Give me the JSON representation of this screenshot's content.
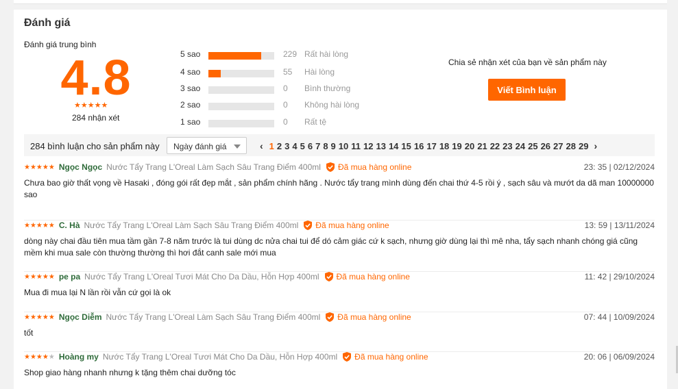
{
  "section_title": "Đánh giá",
  "summary": {
    "label": "Đánh giá trung bình",
    "score": "4.8",
    "stars": "★★★★★",
    "count_text": "284 nhận xét"
  },
  "distribution": [
    {
      "label": "5 sao",
      "count": "229",
      "text": "Rất hài lòng",
      "fill": 0.8
    },
    {
      "label": "4 sao",
      "count": "55",
      "text": "Hài lòng",
      "fill": 0.19
    },
    {
      "label": "3 sao",
      "count": "0",
      "text": "Bình thường",
      "fill": 0
    },
    {
      "label": "2 sao",
      "count": "0",
      "text": "Không hài lòng",
      "fill": 0
    },
    {
      "label": "1 sao",
      "count": "0",
      "text": "Rất tệ",
      "fill": 0
    }
  ],
  "share": {
    "text": "Chia sẻ nhận xét của bạn về sản phẩm này",
    "button": "Viết Bình luận"
  },
  "toolbar": {
    "count_text": "284 bình luận cho sản phẩm này",
    "sort_label": "Ngày đánh giá"
  },
  "pagination": {
    "prev": "‹",
    "next": "›",
    "active": "1",
    "pages": [
      "1",
      "2",
      "3",
      "4",
      "5",
      "6",
      "7",
      "8",
      "9",
      "10",
      "11",
      "12",
      "13",
      "14",
      "15",
      "16",
      "17",
      "18",
      "19",
      "20",
      "21",
      "22",
      "23",
      "24",
      "25",
      "26",
      "27",
      "28",
      "29"
    ]
  },
  "reviews": [
    {
      "stars": "★★★★★",
      "stars_off": "",
      "author": "Ngọc Ngọc",
      "product": "Nước Tẩy Trang L'Oreal Làm Sạch Sâu Trang Điểm 400ml",
      "verified": "Đã mua hàng online",
      "time": "23: 35 | 02/12/2024",
      "body": "Chưa bao giờ thất vọng về Hasaki , đóng gói rất đẹp mắt , sản phẩm chính hãng . Nước tẩy trang mình dùng đến chai thứ 4-5 rồi ý , sạch sâu và mướt da dã man 10000000 sao"
    },
    {
      "stars": "★★★★★",
      "stars_off": "",
      "author": "C. Hà",
      "product": "Nước Tẩy Trang L'Oreal Làm Sạch Sâu Trang Điểm 400ml",
      "verified": "Đã mua hàng online",
      "time": "13: 59 | 13/11/2024",
      "body": "dòng này chai đầu tiên mua tầm gần 7-8 năm trước là tui dùng dc nửa chai tui để dó cảm giác cứ k sạch, nhưng giờ dùng lại thì mê nha, tẩy sạch nhanh chóng giá cũng mềm khi mua sale còn thường thường thì hơi đắt canh sale mới mua"
    },
    {
      "stars": "★★★★★",
      "stars_off": "",
      "author": "pe pa",
      "product": "Nước Tẩy Trang L'Oreal Tươi Mát Cho Da Dầu, Hỗn Hợp 400ml",
      "verified": "Đã mua hàng online",
      "time": "11: 42 | 29/10/2024",
      "body": "Mua đi mua lại N lần rồi vẫn cứ gọi là ok"
    },
    {
      "stars": "★★★★★",
      "stars_off": "",
      "author": "Ngọc Diễm",
      "product": "Nước Tẩy Trang L'Oreal Làm Sạch Sâu Trang Điểm 400ml",
      "verified": "Đã mua hàng online",
      "time": "07: 44 | 10/09/2024",
      "body": "tốt"
    },
    {
      "stars": "★★★★",
      "stars_off": "★",
      "author": "Hoàng my",
      "product": "Nước Tẩy Trang L'Oreal Tươi Mát Cho Da Dầu, Hỗn Hợp 400ml",
      "verified": "Đã mua hàng online",
      "time": "20: 06 | 06/09/2024",
      "body": "Shop giao hàng nhanh nhưng k tặng thêm chai dưỡng tóc"
    }
  ]
}
